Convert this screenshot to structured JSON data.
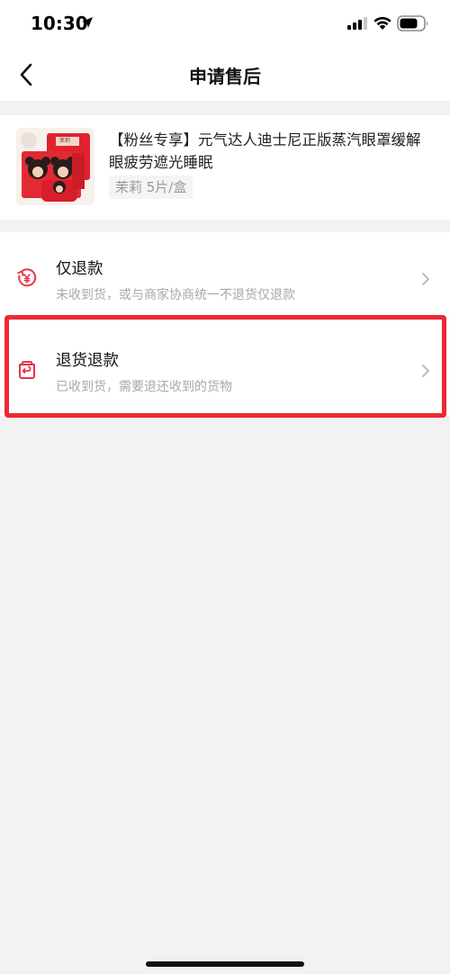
{
  "status_bar": {
    "time": "10:30"
  },
  "header": {
    "title": "申请售后"
  },
  "product": {
    "title": "【粉丝专享】元气达人迪士尼正版蒸汽眼罩缓解眼疲劳遮光睡眠",
    "spec": "茉莉 5片/盒",
    "image_box_label": "茉莉"
  },
  "options": [
    {
      "title": "仅退款",
      "description": "未收到货，或与商家协商统一不退货仅退款",
      "icon": "refund-yuan-icon"
    },
    {
      "title": "退货退款",
      "description": "已收到货，需要退还收到的货物",
      "icon": "return-box-icon"
    }
  ],
  "colors": {
    "accent_red": "#e8344a",
    "highlight_border": "#ec2a33",
    "background": "#f2f2f2",
    "secondary_text": "#a8a8a8"
  }
}
